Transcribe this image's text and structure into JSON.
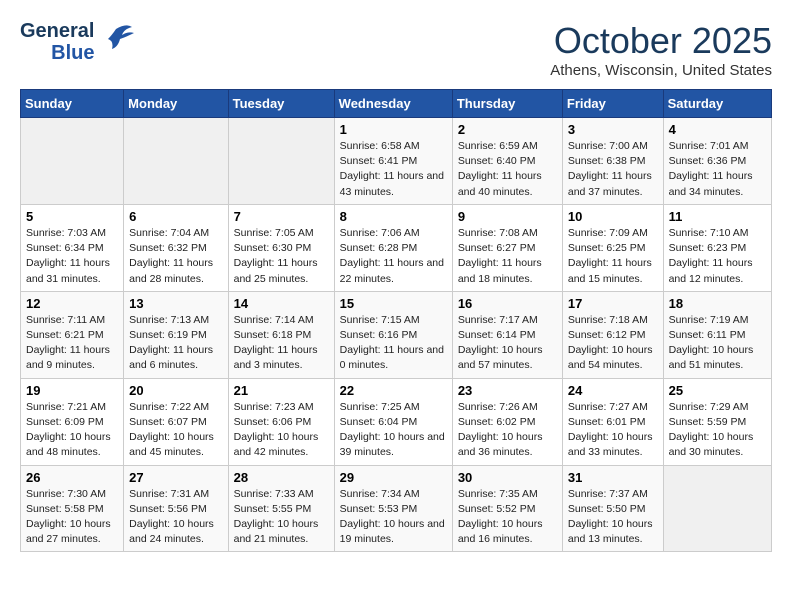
{
  "header": {
    "logo_line1": "General",
    "logo_line2": "Blue",
    "month": "October 2025",
    "location": "Athens, Wisconsin, United States"
  },
  "days_of_week": [
    "Sunday",
    "Monday",
    "Tuesday",
    "Wednesday",
    "Thursday",
    "Friday",
    "Saturday"
  ],
  "weeks": [
    [
      {
        "num": "",
        "empty": true
      },
      {
        "num": "",
        "empty": true
      },
      {
        "num": "",
        "empty": true
      },
      {
        "num": "1",
        "sunrise": "Sunrise: 6:58 AM",
        "sunset": "Sunset: 6:41 PM",
        "daylight": "Daylight: 11 hours and 43 minutes."
      },
      {
        "num": "2",
        "sunrise": "Sunrise: 6:59 AM",
        "sunset": "Sunset: 6:40 PM",
        "daylight": "Daylight: 11 hours and 40 minutes."
      },
      {
        "num": "3",
        "sunrise": "Sunrise: 7:00 AM",
        "sunset": "Sunset: 6:38 PM",
        "daylight": "Daylight: 11 hours and 37 minutes."
      },
      {
        "num": "4",
        "sunrise": "Sunrise: 7:01 AM",
        "sunset": "Sunset: 6:36 PM",
        "daylight": "Daylight: 11 hours and 34 minutes."
      }
    ],
    [
      {
        "num": "5",
        "sunrise": "Sunrise: 7:03 AM",
        "sunset": "Sunset: 6:34 PM",
        "daylight": "Daylight: 11 hours and 31 minutes."
      },
      {
        "num": "6",
        "sunrise": "Sunrise: 7:04 AM",
        "sunset": "Sunset: 6:32 PM",
        "daylight": "Daylight: 11 hours and 28 minutes."
      },
      {
        "num": "7",
        "sunrise": "Sunrise: 7:05 AM",
        "sunset": "Sunset: 6:30 PM",
        "daylight": "Daylight: 11 hours and 25 minutes."
      },
      {
        "num": "8",
        "sunrise": "Sunrise: 7:06 AM",
        "sunset": "Sunset: 6:28 PM",
        "daylight": "Daylight: 11 hours and 22 minutes."
      },
      {
        "num": "9",
        "sunrise": "Sunrise: 7:08 AM",
        "sunset": "Sunset: 6:27 PM",
        "daylight": "Daylight: 11 hours and 18 minutes."
      },
      {
        "num": "10",
        "sunrise": "Sunrise: 7:09 AM",
        "sunset": "Sunset: 6:25 PM",
        "daylight": "Daylight: 11 hours and 15 minutes."
      },
      {
        "num": "11",
        "sunrise": "Sunrise: 7:10 AM",
        "sunset": "Sunset: 6:23 PM",
        "daylight": "Daylight: 11 hours and 12 minutes."
      }
    ],
    [
      {
        "num": "12",
        "sunrise": "Sunrise: 7:11 AM",
        "sunset": "Sunset: 6:21 PM",
        "daylight": "Daylight: 11 hours and 9 minutes."
      },
      {
        "num": "13",
        "sunrise": "Sunrise: 7:13 AM",
        "sunset": "Sunset: 6:19 PM",
        "daylight": "Daylight: 11 hours and 6 minutes."
      },
      {
        "num": "14",
        "sunrise": "Sunrise: 7:14 AM",
        "sunset": "Sunset: 6:18 PM",
        "daylight": "Daylight: 11 hours and 3 minutes."
      },
      {
        "num": "15",
        "sunrise": "Sunrise: 7:15 AM",
        "sunset": "Sunset: 6:16 PM",
        "daylight": "Daylight: 11 hours and 0 minutes."
      },
      {
        "num": "16",
        "sunrise": "Sunrise: 7:17 AM",
        "sunset": "Sunset: 6:14 PM",
        "daylight": "Daylight: 10 hours and 57 minutes."
      },
      {
        "num": "17",
        "sunrise": "Sunrise: 7:18 AM",
        "sunset": "Sunset: 6:12 PM",
        "daylight": "Daylight: 10 hours and 54 minutes."
      },
      {
        "num": "18",
        "sunrise": "Sunrise: 7:19 AM",
        "sunset": "Sunset: 6:11 PM",
        "daylight": "Daylight: 10 hours and 51 minutes."
      }
    ],
    [
      {
        "num": "19",
        "sunrise": "Sunrise: 7:21 AM",
        "sunset": "Sunset: 6:09 PM",
        "daylight": "Daylight: 10 hours and 48 minutes."
      },
      {
        "num": "20",
        "sunrise": "Sunrise: 7:22 AM",
        "sunset": "Sunset: 6:07 PM",
        "daylight": "Daylight: 10 hours and 45 minutes."
      },
      {
        "num": "21",
        "sunrise": "Sunrise: 7:23 AM",
        "sunset": "Sunset: 6:06 PM",
        "daylight": "Daylight: 10 hours and 42 minutes."
      },
      {
        "num": "22",
        "sunrise": "Sunrise: 7:25 AM",
        "sunset": "Sunset: 6:04 PM",
        "daylight": "Daylight: 10 hours and 39 minutes."
      },
      {
        "num": "23",
        "sunrise": "Sunrise: 7:26 AM",
        "sunset": "Sunset: 6:02 PM",
        "daylight": "Daylight: 10 hours and 36 minutes."
      },
      {
        "num": "24",
        "sunrise": "Sunrise: 7:27 AM",
        "sunset": "Sunset: 6:01 PM",
        "daylight": "Daylight: 10 hours and 33 minutes."
      },
      {
        "num": "25",
        "sunrise": "Sunrise: 7:29 AM",
        "sunset": "Sunset: 5:59 PM",
        "daylight": "Daylight: 10 hours and 30 minutes."
      }
    ],
    [
      {
        "num": "26",
        "sunrise": "Sunrise: 7:30 AM",
        "sunset": "Sunset: 5:58 PM",
        "daylight": "Daylight: 10 hours and 27 minutes."
      },
      {
        "num": "27",
        "sunrise": "Sunrise: 7:31 AM",
        "sunset": "Sunset: 5:56 PM",
        "daylight": "Daylight: 10 hours and 24 minutes."
      },
      {
        "num": "28",
        "sunrise": "Sunrise: 7:33 AM",
        "sunset": "Sunset: 5:55 PM",
        "daylight": "Daylight: 10 hours and 21 minutes."
      },
      {
        "num": "29",
        "sunrise": "Sunrise: 7:34 AM",
        "sunset": "Sunset: 5:53 PM",
        "daylight": "Daylight: 10 hours and 19 minutes."
      },
      {
        "num": "30",
        "sunrise": "Sunrise: 7:35 AM",
        "sunset": "Sunset: 5:52 PM",
        "daylight": "Daylight: 10 hours and 16 minutes."
      },
      {
        "num": "31",
        "sunrise": "Sunrise: 7:37 AM",
        "sunset": "Sunset: 5:50 PM",
        "daylight": "Daylight: 10 hours and 13 minutes."
      },
      {
        "num": "",
        "empty": true
      }
    ]
  ]
}
